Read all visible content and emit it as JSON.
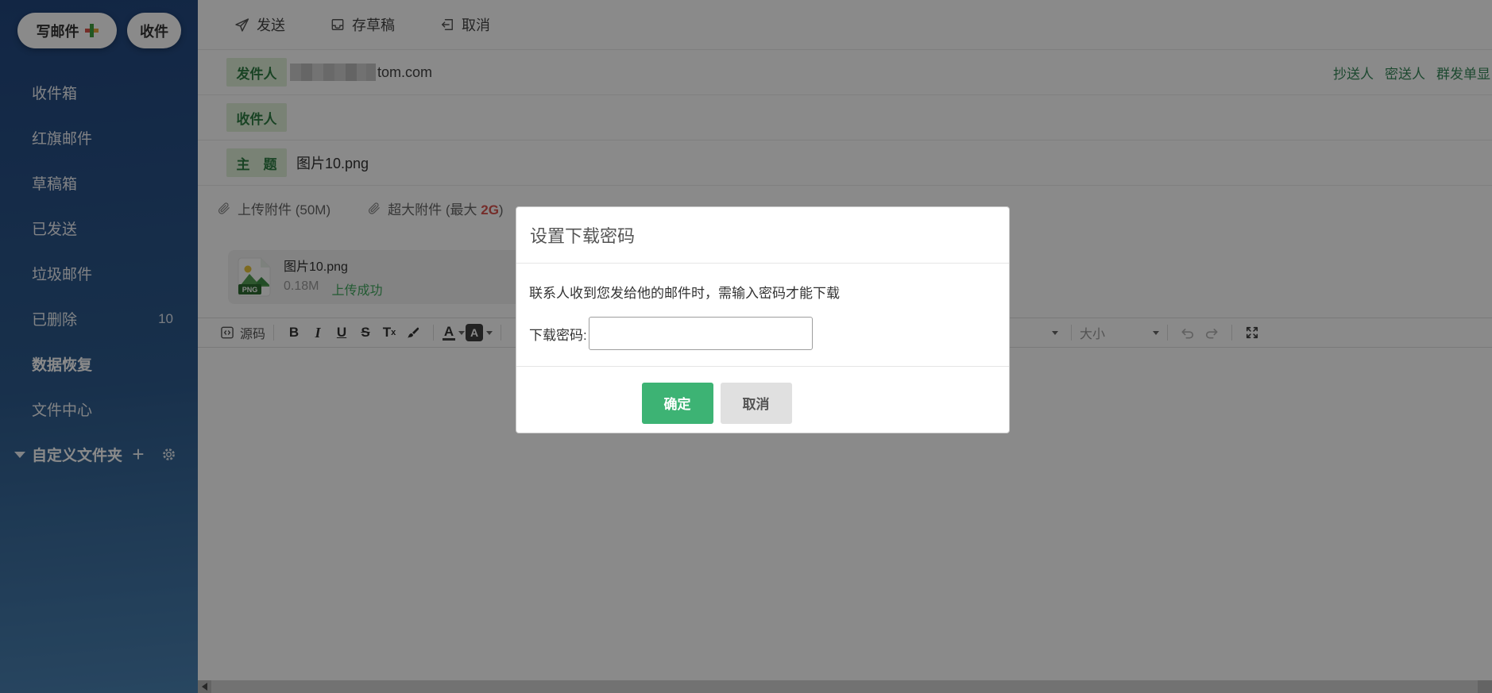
{
  "colors": {
    "accent_green": "#3db374",
    "link_green": "#37875a",
    "badge_green_bg": "#dff0d8",
    "badge_green_text": "#2f7d43",
    "danger_red": "#d9534f",
    "success_green": "#42a85f",
    "sidebar_gradient_top": "#22477f",
    "sidebar_gradient_bottom": "#4a82b2"
  },
  "sidebar": {
    "compose_label": "写邮件",
    "receive_label": "收件",
    "items": [
      {
        "label": "收件箱",
        "count": ""
      },
      {
        "label": "红旗邮件",
        "count": ""
      },
      {
        "label": "草稿箱",
        "count": ""
      },
      {
        "label": "已发送",
        "count": ""
      },
      {
        "label": "垃圾邮件",
        "count": ""
      },
      {
        "label": "已删除",
        "count": "10"
      },
      {
        "label": "数据恢复",
        "count": ""
      },
      {
        "label": "文件中心",
        "count": ""
      }
    ],
    "custom_folder_label": "自定义文件夹",
    "add_folder_glyph": "+"
  },
  "toolbar": {
    "send": "发送",
    "save_draft": "存草稿",
    "cancel": "取消"
  },
  "compose": {
    "from_label": "发件人",
    "from_value_domain": "tom.com",
    "to_label": "收件人",
    "subject_label": "主　题",
    "subject_value": "图片10.png",
    "cc_link": "抄送人",
    "bcc_link": "密送人",
    "mass_link": "群发单显",
    "upload_attachment": "上传附件 (50M)",
    "large_attachment_prefix": "超大附件 (最大 ",
    "large_attachment_max": "2G",
    "large_attachment_suffix": ")"
  },
  "attachment": {
    "filename": "图片10.png",
    "type_badge": "PNG",
    "size": "0.18M",
    "status": "上传成功"
  },
  "editor": {
    "source": "源码",
    "bold": "B",
    "italic": "I",
    "underline": "U",
    "strikethrough": "S",
    "clear_t": "T",
    "clear_x": "x",
    "font_color_letter": "A",
    "bg_color_letter": "A",
    "size": "大小"
  },
  "modal": {
    "title": "设置下载密码",
    "description": "联系人收到您发给他的邮件时，需输入密码才能下载",
    "password_label": "下载密码:",
    "confirm": "确定",
    "cancel": "取消"
  }
}
